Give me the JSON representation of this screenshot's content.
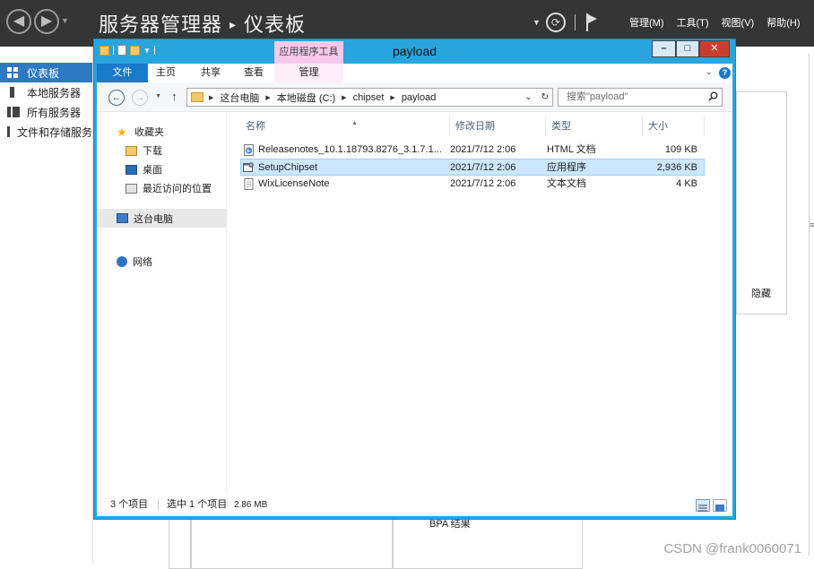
{
  "server_manager": {
    "title": "服务器管理器",
    "breadcrumb": "仪表板",
    "menu": [
      "管理(M)",
      "工具(T)",
      "视图(V)",
      "帮助(H)"
    ],
    "sidebar": [
      {
        "label": "仪表板"
      },
      {
        "label": "本地服务器"
      },
      {
        "label": "所有服务器"
      },
      {
        "label": "文件和存储服务"
      }
    ],
    "hide_label": "隐藏",
    "bpa_label": "BPA 结果",
    "watermark": "CSDN @frank0060071"
  },
  "explorer": {
    "window_title": "payload",
    "context_tab": "应用程序工具",
    "ribbon_tabs": [
      "文件",
      "主页",
      "共享",
      "查看",
      "管理"
    ],
    "address": [
      "这台电脑",
      "本地磁盘 (C:)",
      "chipset",
      "payload"
    ],
    "search_placeholder": "搜索\"payload\"",
    "nav": {
      "favorites": "收藏夹",
      "downloads": "下载",
      "desktop": "桌面",
      "recent": "最近访问的位置",
      "this_pc": "这台电脑",
      "network": "网络"
    },
    "columns": [
      "名称",
      "修改日期",
      "类型",
      "大小"
    ],
    "files": [
      {
        "name": "Releasenotes_10.1.18793.8276_3.1.7.1...",
        "date": "2021/7/12 2:06",
        "type": "HTML 文档",
        "size": "109 KB",
        "icon": "html-file-icon"
      },
      {
        "name": "SetupChipset",
        "date": "2021/7/12 2:06",
        "type": "应用程序",
        "size": "2,936 KB",
        "icon": "setup-exe-icon"
      },
      {
        "name": "WixLicenseNote",
        "date": "2021/7/12 2:06",
        "type": "文本文档",
        "size": "4 KB",
        "icon": "text-file-icon"
      }
    ],
    "status": {
      "count": "3 个项目",
      "selection": "选中 1 个项目",
      "selection_size": "2.86 MB"
    }
  },
  "colors": {
    "window_frame": "#29a5dd",
    "file_tab": "#1979ca",
    "context_tab": "#f6c8ec",
    "selection": "#cce8ff",
    "sm_header": "#353535",
    "sm_active": "#2e79c4"
  }
}
